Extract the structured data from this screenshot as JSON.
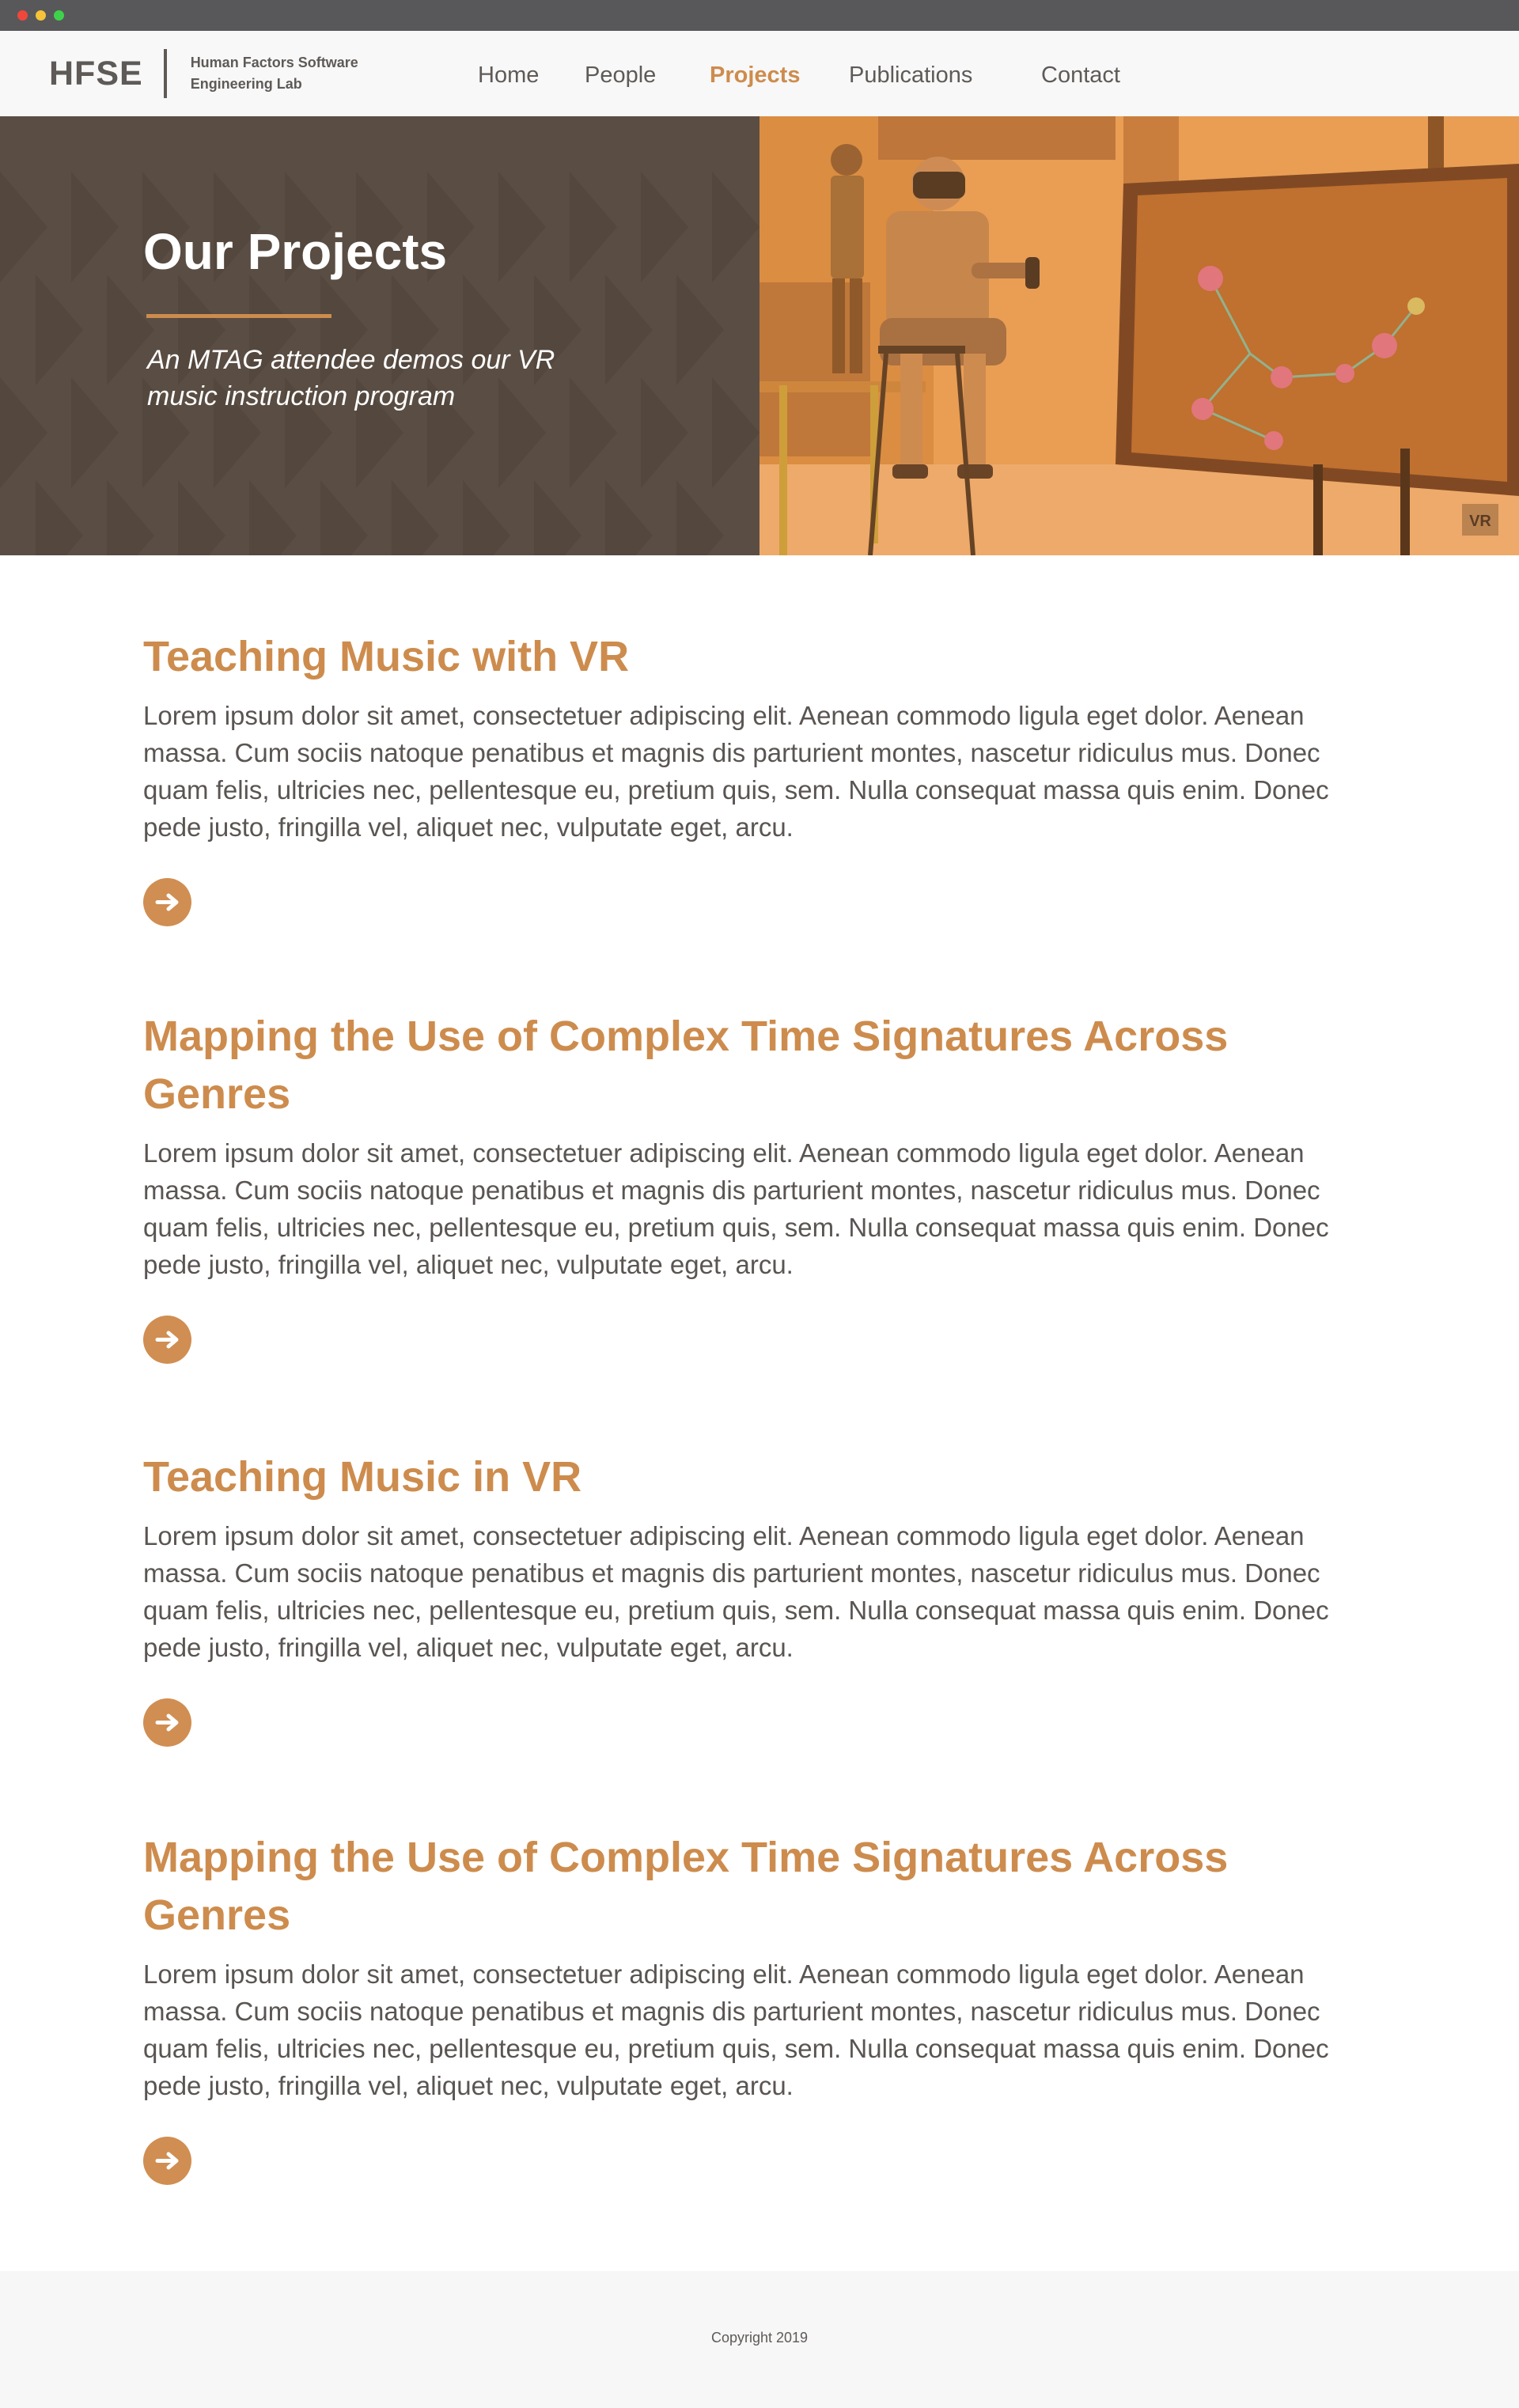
{
  "site": {
    "logo_mark": "HFSE",
    "logo_text": "Human Factors Software Engineering Lab"
  },
  "nav": {
    "items": [
      {
        "label": "Home"
      },
      {
        "label": "People"
      },
      {
        "label": "Projects",
        "active": true
      },
      {
        "label": "Publications"
      },
      {
        "label": "Contact"
      }
    ]
  },
  "hero": {
    "title": "Our Projects",
    "subtitle": "An MTAG attendee demos our VR music instruction program",
    "photo_badge": "VR"
  },
  "projects": [
    {
      "title": "Teaching Music with VR",
      "description": "Lorem ipsum dolor sit amet, consectetuer adipiscing elit. Aenean commodo  ligula eget dolor. Aenean massa. Cum sociis natoque penatibus et magnis dis parturient montes, nascetur ridiculus mus. Donec quam felis, ultricies nec, pellentesque eu, pretium quis, sem. Nulla consequat massa quis enim. Donec pede justo, fringilla vel, aliquet nec, vulputate eget, arcu.",
      "link_icon": "arrow-right-icon"
    },
    {
      "title": "Mapping the Use of Complex Time Signatures Across Genres",
      "description": "Lorem ipsum dolor sit amet, consectetuer adipiscing elit. Aenean commodo  ligula eget dolor. Aenean massa. Cum sociis natoque penatibus et magnis dis parturient montes, nascetur ridiculus mus. Donec quam felis, ultricies nec, pellentesque eu, pretium quis, sem. Nulla consequat massa quis enim. Donec pede justo, fringilla vel, aliquet nec, vulputate eget, arcu.",
      "link_icon": "arrow-right-icon"
    },
    {
      "title": "Teaching Music in VR",
      "description": "Lorem ipsum dolor sit amet, consectetuer adipiscing elit. Aenean commodo  ligula eget dolor. Aenean massa. Cum sociis natoque penatibus et magnis dis parturient montes, nascetur ridiculus mus. Donec quam felis, ultricies nec, pellentesque eu, pretium quis, sem. Nulla consequat massa quis enim. Donec pede justo, fringilla vel, aliquet nec, vulputate eget, arcu.",
      "link_icon": "arrow-right-icon"
    },
    {
      "title": "Mapping the Use of Complex Time Signatures Across Genres",
      "description": "Lorem ipsum dolor sit amet, consectetuer adipiscing elit. Aenean commodo  ligula eget dolor. Aenean massa. Cum sociis natoque penatibus et magnis dis parturient montes, nascetur ridiculus mus. Donec quam felis, ultricies nec, pellentesque eu, pretium quis, sem. Nulla consequat massa quis enim. Donec pede justo, fringilla vel, aliquet nec, vulputate eget, arcu.",
      "link_icon": "arrow-right-icon"
    }
  ],
  "footer": {
    "copyright": "Copyright 2019"
  },
  "colors": {
    "accent": "#cd8c4d",
    "text": "#5a5552",
    "hero_dark": "#5a4d43",
    "chrome": "#58585a"
  }
}
